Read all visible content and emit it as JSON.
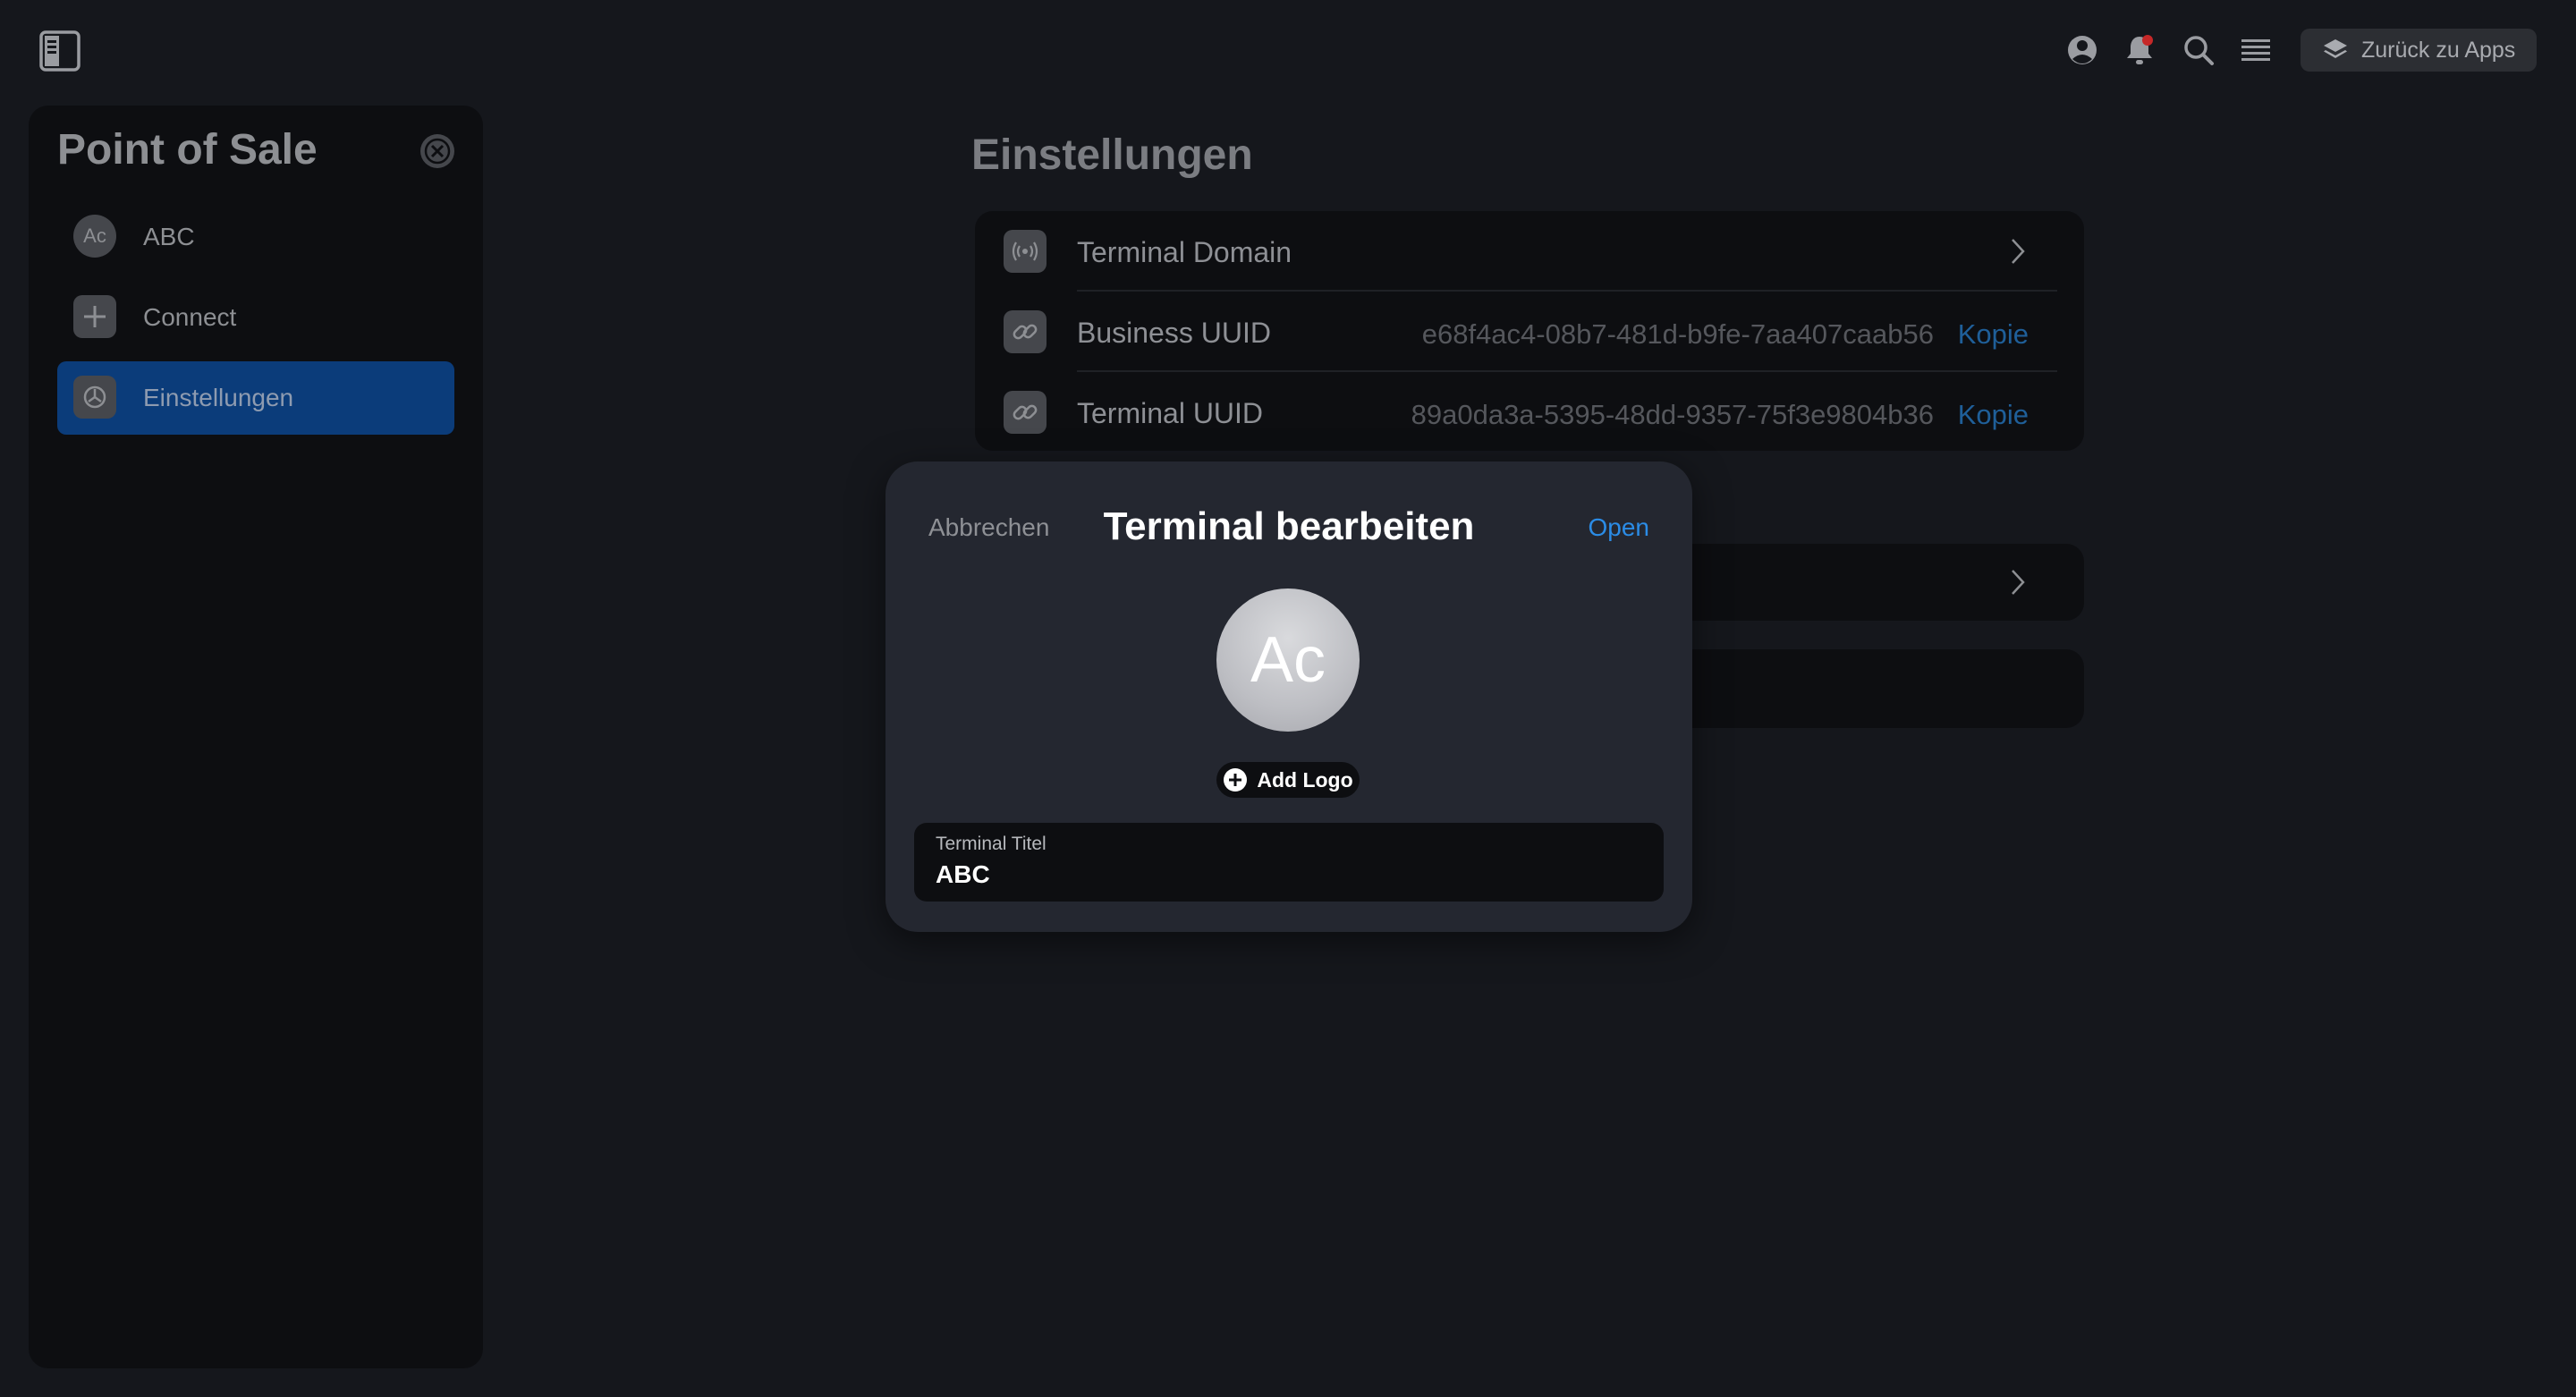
{
  "topbar": {
    "back_to_apps_label": "Zurück zu Apps",
    "icons": [
      "sidebar-toggle-icon",
      "user-circle-icon",
      "bell-icon",
      "search-icon",
      "menu-icon",
      "layers-icon"
    ],
    "notification_dot_color": "#c62828"
  },
  "sidebar": {
    "title": "Point of Sale",
    "items": [
      {
        "label": "ABC",
        "icon_text": "Ac",
        "active": false
      },
      {
        "label": "Connect",
        "icon_text": "+",
        "active": false
      },
      {
        "label": "Einstellungen",
        "icon_text": "",
        "active": true
      }
    ],
    "active_color": "#0b3c7a"
  },
  "main": {
    "title": "Einstellungen",
    "rows": [
      {
        "label": "Terminal Domain",
        "value": "",
        "action": ""
      },
      {
        "label": "Business UUID",
        "value": "e68f4ac4-08b7-481d-b9fe-7aa407caab56",
        "action": "Kopie"
      },
      {
        "label": "Terminal UUID",
        "value": "89a0da3a-5395-48dd-9357-75f3e9804b36",
        "action": "Kopie"
      }
    ]
  },
  "modal": {
    "cancel_label": "Abbrechen",
    "title": "Terminal bearbeiten",
    "open_label": "Open",
    "avatar_text": "Ac",
    "add_logo_label": "Add Logo",
    "field_label": "Terminal Titel",
    "field_value": "ABC",
    "accent_color": "#2b8ce6"
  }
}
